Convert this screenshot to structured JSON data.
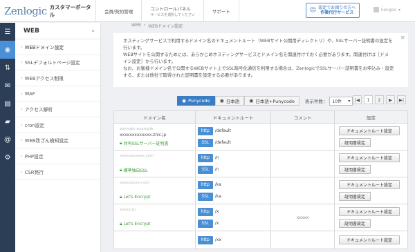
{
  "header": {
    "logo": "Zenlogic",
    "portal": "カスタマーポータル",
    "nav": [
      {
        "label": "会員/契約管理",
        "sub": ""
      },
      {
        "label": "コントロールパネル",
        "sub": "サービスを選択してください"
      },
      {
        "label": "サポート",
        "sub": ""
      }
    ],
    "banner_line1": "設定でお困りの方へ",
    "banner_line2": "作業代行サービス",
    "user": "kangeo"
  },
  "iconbar": [
    "menu-icon",
    "globe-icon",
    "arrows-icon",
    "mail-icon",
    "server-icon",
    "folder-icon",
    "at-icon",
    "gear-icon"
  ],
  "sidebar": {
    "title": "WEB",
    "collapse": "«",
    "items": [
      {
        "label": "WEBドメイン設定"
      },
      {
        "label": "SSLデフォルトページ設定"
      },
      {
        "label": "WEBアクセス制限"
      },
      {
        "label": "WAF"
      },
      {
        "label": "アクセス解析"
      },
      {
        "label": "cron設定"
      },
      {
        "label": "WEB改ざん検知設定"
      },
      {
        "label": "PHP設定"
      },
      {
        "label": "CSR発行"
      }
    ]
  },
  "breadcrumb": [
    "WEB",
    "›",
    "WEBドメイン設定"
  ],
  "info": {
    "line1": "ホスティングサービスで利用するドメイン名のドキュメントルート（WEBサイト公開用ディレクトリ）や、SSLサーバー証明書の設定を",
    "line2": "行います。",
    "line3": "WEBサイトを公開するためには、あらかじめホスティングサービスとドメイン名を関連付けておく必要があります。関連付けは［ドメ",
    "line4": "イン設定］から行います。",
    "line5": "なお、お客様ドメイン名で公開するWEBサイト上でSSL暗号化通信を利用する場合は、ZenlogicでSSLサーバー証明書をお申込み・設定",
    "line6": "する、または他社で取得された証明書を設定する必要があります。"
  },
  "tabs": [
    {
      "label": "Punycode"
    },
    {
      "label": "日本語"
    },
    {
      "label": "日本語+Punycode"
    }
  ],
  "count_label": "表示件数：",
  "count_value": "10件",
  "pager": [
    "|◀",
    "1",
    "2",
    "▶",
    "▶|"
  ],
  "table": {
    "headers": {
      "domain": "ドメイン名",
      "docroot": "ドキュメントルート",
      "comment": "コメント",
      "setting": "設定"
    },
    "rows": [
      {
        "d1": "zenlogic-example",
        "d2": "xxxxxxxxxxxxx.znlc.jp",
        "ssl": "共有SSLサーバー証明書",
        "http": "/default",
        "https": "/default",
        "comment": ""
      },
      {
        "d1": "xxxxxxxxxxx.com",
        "d2": "",
        "ssl": "標準独自SSL",
        "http": "/n",
        "https": "/n",
        "comment": ""
      },
      {
        "d1": "xxxxxxxxx.com",
        "d2": "",
        "ssl": "Let's Encrypt",
        "http": "/ka",
        "https": "/ka",
        "comment": ""
      },
      {
        "d1": "xxxxx.jp",
        "d2": "",
        "ssl": "Let's Encrypt",
        "http": "/x",
        "https": "/x",
        "comment": "xxxxx"
      },
      {
        "d1": "",
        "d2": "",
        "ssl": "",
        "http": "/xx",
        "https": "",
        "comment": ""
      }
    ],
    "proto_http": "http",
    "proto_ssl": "SSL",
    "btn_docroot": "ドキュメントルート設定",
    "btn_cert": "証明書設定"
  }
}
